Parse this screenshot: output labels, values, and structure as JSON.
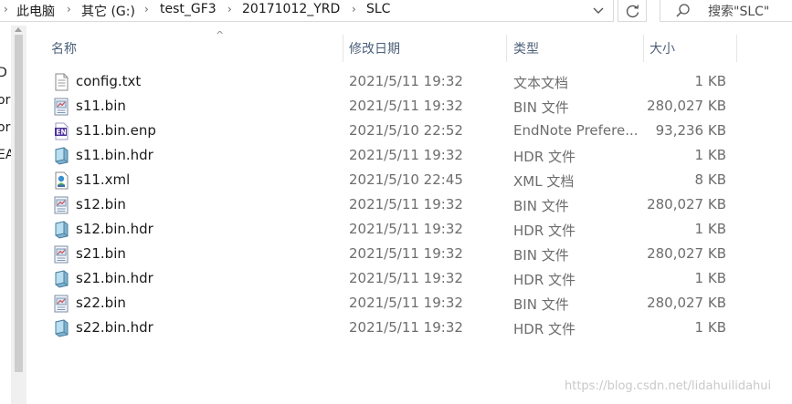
{
  "breadcrumb": [
    "此电脑",
    "其它 (G:)",
    "test_GF3",
    "20171012_YRD",
    "SLC"
  ],
  "search": {
    "placeholder": "搜索\"SLC\""
  },
  "left_pane_fragments": [
    "D",
    "or",
    "or",
    "EA"
  ],
  "columns": {
    "name": "名称",
    "date": "修改日期",
    "type": "类型",
    "size": "大小"
  },
  "files": [
    {
      "name": "config.txt",
      "date": "2021/5/11 19:32",
      "type": "文本文档",
      "size": "1 KB",
      "icon": "text-file-icon"
    },
    {
      "name": "s11.bin",
      "date": "2021/5/11 19:32",
      "type": "BIN 文件",
      "size": "280,027 KB",
      "icon": "bin-file-icon"
    },
    {
      "name": "s11.bin.enp",
      "date": "2021/5/10 22:52",
      "type": "EndNote Prefere...",
      "size": "93,236 KB",
      "icon": "endnote-file-icon"
    },
    {
      "name": "s11.bin.hdr",
      "date": "2021/5/11 19:32",
      "type": "HDR 文件",
      "size": "1 KB",
      "icon": "hdr-file-icon"
    },
    {
      "name": "s11.xml",
      "date": "2021/5/10 22:45",
      "type": "XML 文档",
      "size": "8 KB",
      "icon": "xml-file-icon"
    },
    {
      "name": "s12.bin",
      "date": "2021/5/11 19:32",
      "type": "BIN 文件",
      "size": "280,027 KB",
      "icon": "bin-file-icon"
    },
    {
      "name": "s12.bin.hdr",
      "date": "2021/5/11 19:32",
      "type": "HDR 文件",
      "size": "1 KB",
      "icon": "hdr-file-icon"
    },
    {
      "name": "s21.bin",
      "date": "2021/5/11 19:32",
      "type": "BIN 文件",
      "size": "280,027 KB",
      "icon": "bin-file-icon"
    },
    {
      "name": "s21.bin.hdr",
      "date": "2021/5/11 19:32",
      "type": "HDR 文件",
      "size": "1 KB",
      "icon": "hdr-file-icon"
    },
    {
      "name": "s22.bin",
      "date": "2021/5/11 19:32",
      "type": "BIN 文件",
      "size": "280,027 KB",
      "icon": "bin-file-icon"
    },
    {
      "name": "s22.bin.hdr",
      "date": "2021/5/11 19:32",
      "type": "HDR 文件",
      "size": "1 KB",
      "icon": "hdr-file-icon"
    }
  ],
  "watermark": "https://blog.csdn.net/lidahuilidahui"
}
